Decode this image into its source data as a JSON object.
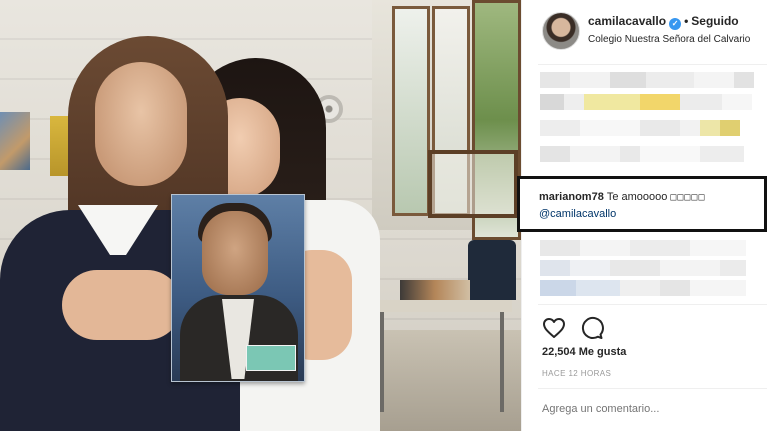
{
  "post": {
    "username": "camilacavallo",
    "separator": "•",
    "follow_status": "Seguido",
    "location": "Colegio Nuestra Señora del Calvario"
  },
  "highlighted_comment": {
    "username": "marianom78",
    "text": "Te amooooo",
    "emoji": "□□□□□",
    "mention": "@camilacavallo"
  },
  "stats": {
    "likes": "22,504 Me gusta",
    "time": "HACE 12 HORAS"
  },
  "comment_input": {
    "placeholder": "Agrega un comentario..."
  },
  "icons": {
    "verified": "verified-badge-icon",
    "like": "heart-icon",
    "comment": "comment-bubble-icon"
  },
  "colors": {
    "accent_blue": "#3897f0",
    "mention_blue": "#003569",
    "text": "#262626",
    "muted": "#999999",
    "highlight_border": "#111111"
  }
}
